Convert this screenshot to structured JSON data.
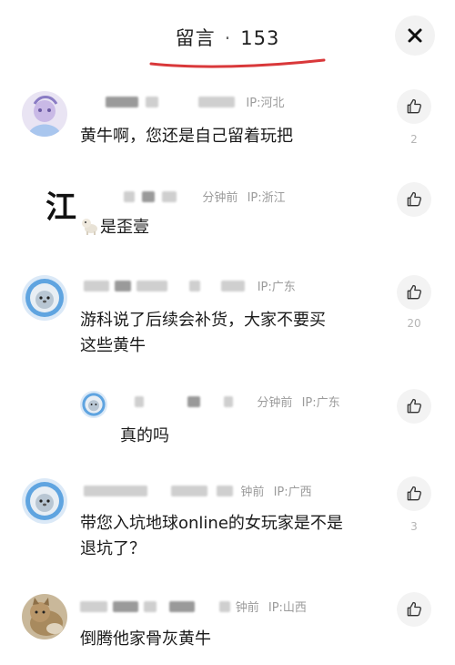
{
  "header": {
    "title": "留言",
    "separator": "·",
    "count": "153"
  },
  "comments": [
    {
      "ip": "IP:河北",
      "time": "",
      "text": "黄牛啊，您还是自己留着玩把",
      "likes": "2"
    },
    {
      "avatar_text": "江",
      "time": "分钟前",
      "ip": "IP:浙江",
      "text": "是歪壹",
      "likes": ""
    },
    {
      "time": "",
      "ip": "IP:广东",
      "text_line1": "游科说了后续会补货，大家不要买",
      "text_line2": "这些黄牛",
      "likes": "20"
    },
    {
      "time": "分钟前",
      "ip": "IP:广东",
      "text": "真的吗",
      "likes": ""
    },
    {
      "time": "钟前",
      "ip": "IP:广西",
      "text_line1": "带您入坑地球online的女玩家是不是",
      "text_line2": "退坑了？",
      "likes": "3"
    },
    {
      "time": "钟前",
      "ip": "IP:山西",
      "text": "倒腾他家骨灰黄牛",
      "likes": ""
    }
  ],
  "icons": {
    "close": "close-icon",
    "like": "thumbs-up-icon"
  },
  "colors": {
    "underline": "#d9383a",
    "meta": "#9b9b9b",
    "like_bg": "#f3f3f3"
  }
}
